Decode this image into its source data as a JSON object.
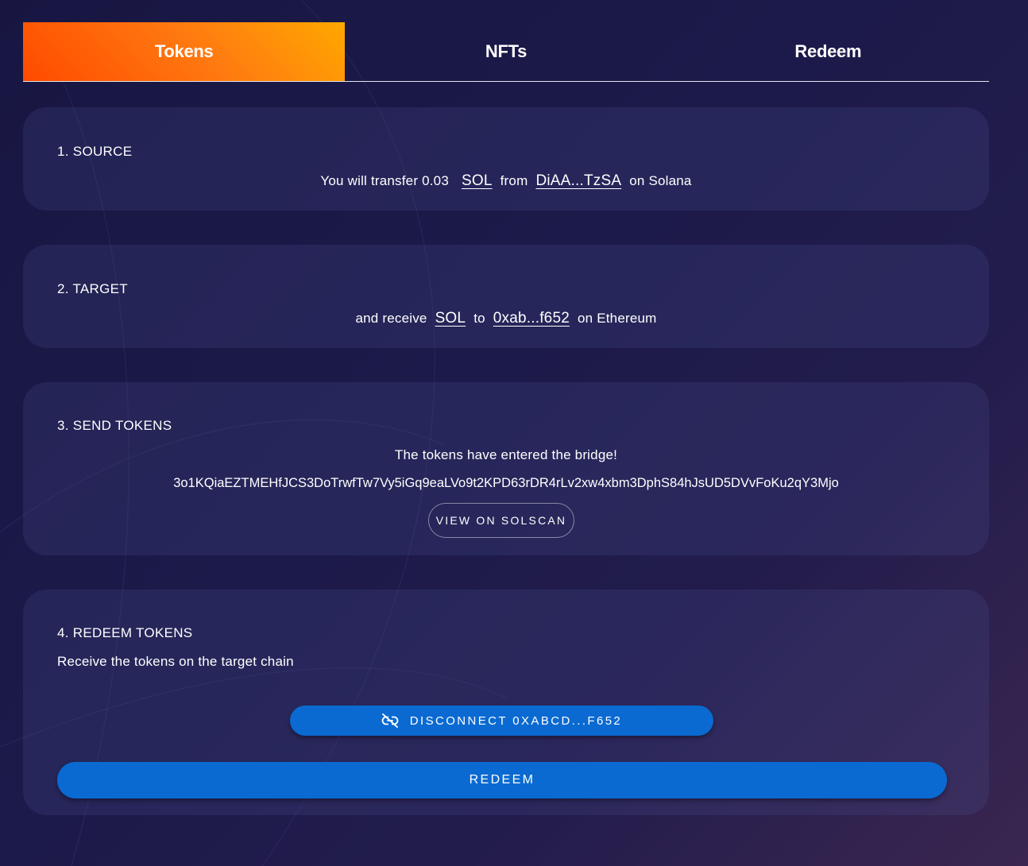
{
  "tabs": [
    {
      "label": "Tokens",
      "active": true
    },
    {
      "label": "NFTs",
      "active": false
    },
    {
      "label": "Redeem",
      "active": false
    }
  ],
  "source": {
    "title": "1. SOURCE",
    "prefix": "You will transfer 0.03",
    "token": "SOL",
    "from_word": "from",
    "address": "DiAA...TzSA",
    "chain": "on Solana"
  },
  "target": {
    "title": "2. TARGET",
    "prefix": "and receive",
    "token": "SOL",
    "to_word": "to",
    "address": "0xab...f652",
    "chain": "on Ethereum"
  },
  "send": {
    "title": "3. SEND TOKENS",
    "status": "The tokens have entered the bridge!",
    "tx_hash": "3o1KQiaEZTMEHfJCS3DoTrwfTw7Vy5iGq9eaLVo9t2KPD63rDR4rLv2xw4xbm3DphS84hJsUD5DVvFoKu2qY3Mjo",
    "view_button": "VIEW ON SOLSCAN"
  },
  "redeem": {
    "title": "4. REDEEM TOKENS",
    "description": "Receive the tokens on the target chain",
    "disconnect_button": "DISCONNECT 0XABCD...F652",
    "redeem_button": "REDEEM"
  },
  "icons": {
    "disconnect": "link-off-icon"
  },
  "colors": {
    "tab_active_start": "#ff4a00",
    "tab_active_end": "#ffa800",
    "button_blue": "#0a6ad1",
    "card_bg": "rgba(78,84,150,0.22)"
  }
}
